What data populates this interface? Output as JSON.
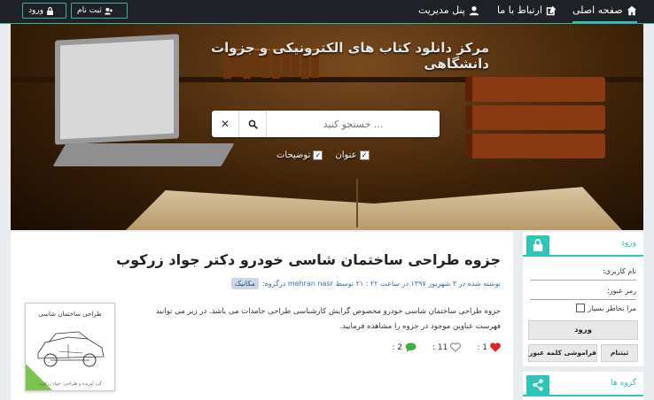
{
  "navbar": {
    "home_label": "صفحه اصلی",
    "contact_label": "ارتباط با ما",
    "admin_label": "پنل مدیریت",
    "register_label": "ثبت نام",
    "login_label": "ورود"
  },
  "hero": {
    "title": "مرکز دانلود کتاب های الکترونیکی و جزوات دانشگاهی",
    "search_placeholder": "جستجو کنید ...",
    "filter_title": "عنوان",
    "filter_description": "توضیحات"
  },
  "post": {
    "title": "جزوه طراحی ساختمان شاسی خودرو دکتر جواد زرکوب",
    "meta": "نوشته شده در ۳ شهریور ۱۳۹۷ در ساعت ۲۲ : ۲۱ توسط mehran nasr درگروه:",
    "category": "مکانیک",
    "body": "جزوه طراحی ساختمان شاسی خودرو مخصوص گرایش کارشناسی طراحی جامدات می باشد. در زیر می توانید فهرست عناوین موجود در جزوه را مشاهده فرمایید.",
    "likes": "1 :",
    "views": "11 :",
    "comments": "2 :",
    "thumb_title": "طراحی ساختمان شاسی",
    "thumb_caption": "گرد آورنده و طراحی: جواد زرکوب"
  },
  "sidebar": {
    "login_head": "ورود",
    "username_label": "نام کاربری:",
    "password_label": "رمز عبور:",
    "remember_label": "مرا بخاطر بسپار",
    "login_button": "ورود",
    "forgot_button": "فراموشی کلمه عبور",
    "register_button": "ثبتنام",
    "groups_head": "گروه ها"
  },
  "colors": {
    "accent": "#2ec4b6",
    "navbar_bg": "#1e2226",
    "link": "#3b6ea8",
    "like": "#e0202a",
    "comment": "#3cb043"
  }
}
